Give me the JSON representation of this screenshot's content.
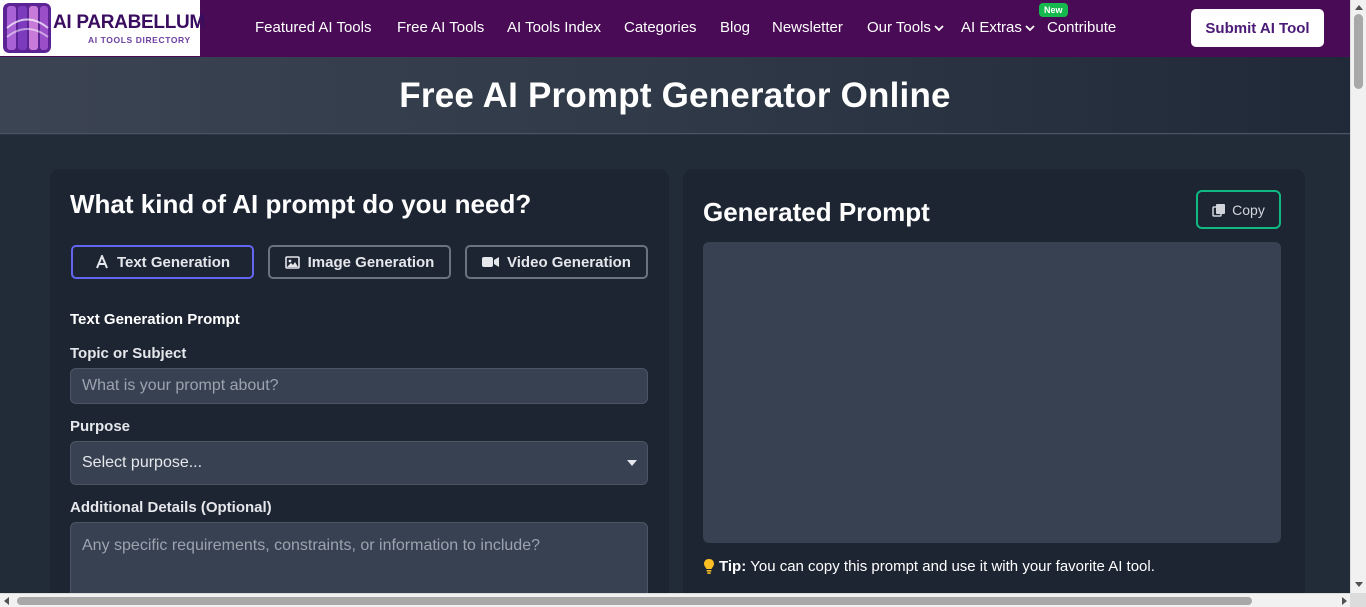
{
  "brand": {
    "name": "AI PARABELLUM",
    "tagline": "AI TOOLS DIRECTORY",
    "logo_colors": [
      "#7a2bb5",
      "#b04ad0",
      "#4a1a8a",
      "#d06ac8"
    ]
  },
  "nav": {
    "items": [
      {
        "label": "Featured AI Tools"
      },
      {
        "label": "Free AI Tools"
      },
      {
        "label": "AI Tools Index"
      },
      {
        "label": "Categories"
      },
      {
        "label": "Blog"
      },
      {
        "label": "Newsletter"
      },
      {
        "label": "Our Tools",
        "dropdown": true
      },
      {
        "label": "AI Extras",
        "dropdown": true
      },
      {
        "label": "Contribute",
        "badge": "New"
      }
    ],
    "submit_label": "Submit AI Tool"
  },
  "hero": {
    "title": "Free AI Prompt Generator Online"
  },
  "form": {
    "question": "What kind of AI prompt do you need?",
    "tabs": [
      {
        "label": "Text Generation",
        "icon": "text-icon",
        "active": true
      },
      {
        "label": "Image Generation",
        "icon": "image-icon",
        "active": false
      },
      {
        "label": "Video Generation",
        "icon": "video-icon",
        "active": false
      }
    ],
    "section_title": "Text Generation Prompt",
    "topic": {
      "label": "Topic or Subject",
      "placeholder": "What is your prompt about?",
      "value": ""
    },
    "purpose": {
      "label": "Purpose",
      "selected": "Select purpose..."
    },
    "details": {
      "label": "Additional Details (Optional)",
      "placeholder": "Any specific requirements, constraints, or information to include?",
      "value": ""
    }
  },
  "output": {
    "title": "Generated Prompt",
    "copy_label": "Copy",
    "content": "",
    "tip_label": "Tip:",
    "tip_text": "You can copy this prompt and use it with your favorite AI tool."
  },
  "colors": {
    "nav_bg": "#490b55",
    "accent_tab": "#6366f1",
    "copy_border": "#10b981",
    "badge": "#15b84c"
  }
}
